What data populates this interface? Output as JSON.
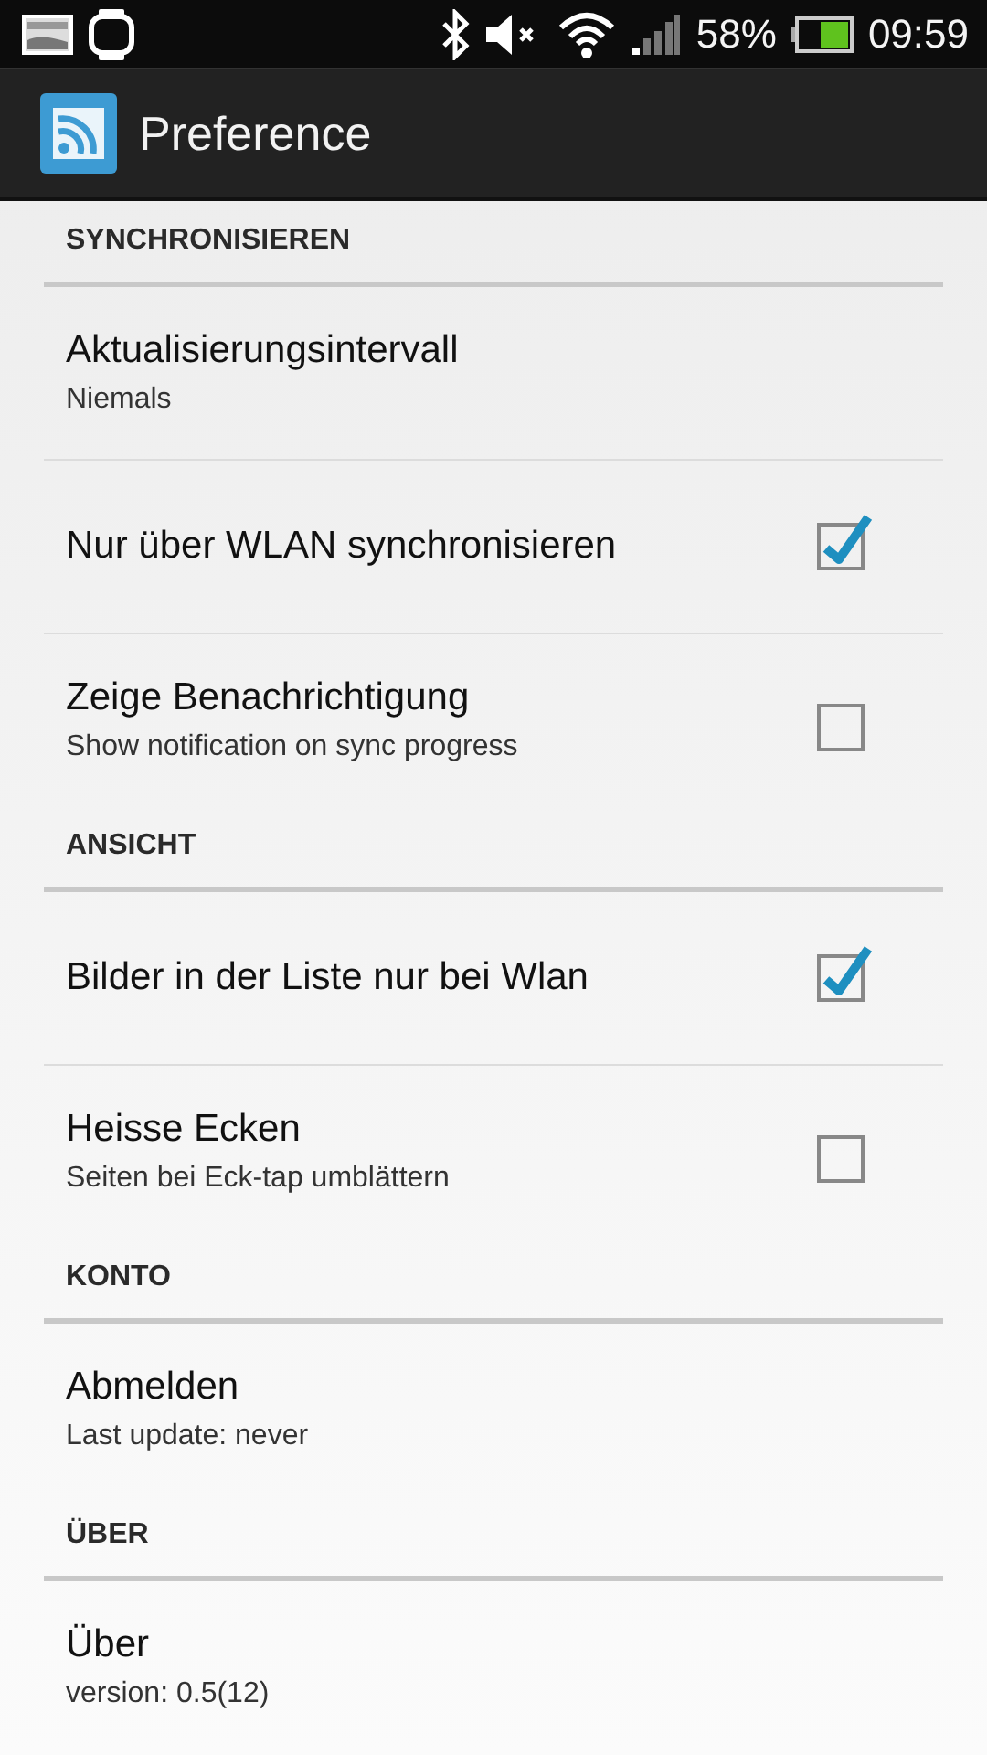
{
  "status_bar": {
    "battery_text": "58%",
    "time": "09:59"
  },
  "action_bar": {
    "title": "Preference"
  },
  "sections": [
    {
      "header": "SYNCHRONISIEREN",
      "items": [
        {
          "kind": "plain",
          "title": "Aktualisierungsintervall",
          "summary": "Niemals"
        },
        {
          "kind": "checkbox",
          "title": "Nur über WLAN synchronisieren",
          "checked": true
        },
        {
          "kind": "checkbox",
          "title": "Zeige Benachrichtigung",
          "summary": "Show notification on sync progress",
          "checked": false
        }
      ]
    },
    {
      "header": "ANSICHT",
      "items": [
        {
          "kind": "checkbox",
          "title": "Bilder in der Liste nur bei Wlan",
          "checked": true
        },
        {
          "kind": "checkbox",
          "title": "Heisse Ecken",
          "summary": "Seiten bei Eck-tap umblättern",
          "checked": false
        }
      ]
    },
    {
      "header": "KONTO",
      "items": [
        {
          "kind": "plain",
          "title": "Abmelden",
          "summary": "Last update: never"
        }
      ]
    },
    {
      "header": "ÜBER",
      "items": [
        {
          "kind": "plain",
          "title": "Über",
          "summary": "version: 0.5(12)"
        }
      ]
    }
  ]
}
